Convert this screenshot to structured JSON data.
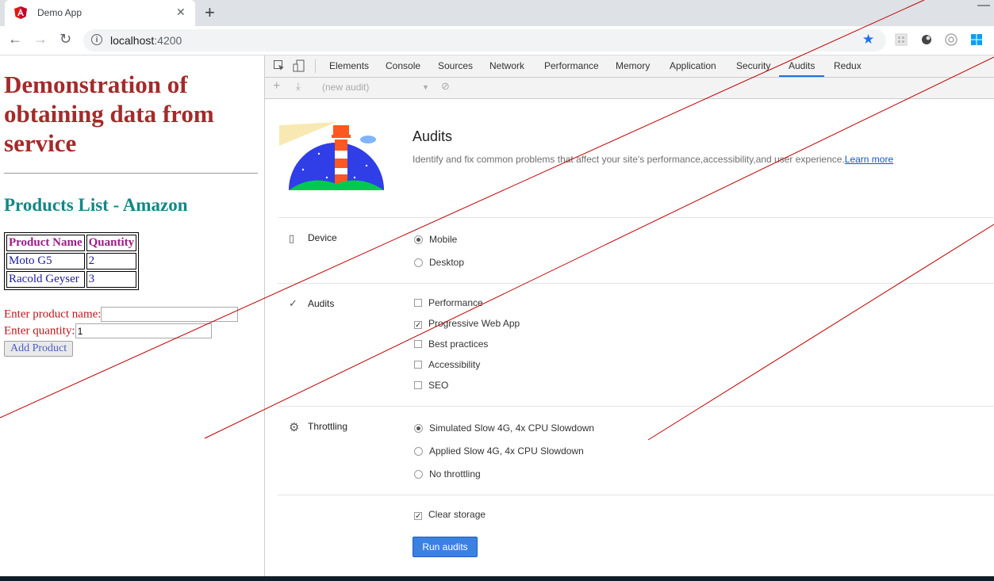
{
  "browser": {
    "tab_title": "Demo App",
    "url_host": "localhost",
    "url_port": ":4200"
  },
  "page": {
    "heading": "Demonstration of obtaining data from service",
    "subheading": "Products List - Amazon",
    "table": {
      "headers": [
        "Product Name",
        "Quantity"
      ],
      "rows": [
        [
          "Moto G5",
          "2"
        ],
        [
          "Racold Geyser",
          "3"
        ]
      ]
    },
    "form": {
      "name_label": "Enter product name:",
      "name_value": "",
      "qty_label": "Enter quantity:",
      "qty_value": "1",
      "add_button": "Add Product"
    }
  },
  "devtools": {
    "tabs": [
      "Elements",
      "Console",
      "Sources",
      "Network",
      "Performance",
      "Memory",
      "Application",
      "Security",
      "Audits",
      "Redux"
    ],
    "active_tab": "Audits",
    "audit_select": "(new audit)",
    "hero": {
      "title": "Audits",
      "description": "Identify and fix common problems that affect your site's performance,accessibility,and user experience.",
      "learn_more": "Learn more"
    },
    "device": {
      "label": "Device",
      "options": [
        {
          "label": "Mobile",
          "checked": true
        },
        {
          "label": "Desktop",
          "checked": false
        }
      ]
    },
    "audits": {
      "label": "Audits",
      "options": [
        {
          "label": "Performance",
          "checked": false
        },
        {
          "label": "Progressive Web App",
          "checked": true
        },
        {
          "label": "Best practices",
          "checked": false
        },
        {
          "label": "Accessibility",
          "checked": false
        },
        {
          "label": "SEO",
          "checked": false
        }
      ]
    },
    "throttling": {
      "label": "Throttling",
      "options": [
        {
          "label": "Simulated Slow 4G, 4x CPU Slowdown",
          "checked": true
        },
        {
          "label": "Applied Slow 4G, 4x CPU Slowdown",
          "checked": false
        },
        {
          "label": "No throttling",
          "checked": false
        }
      ]
    },
    "clear_storage": {
      "label": "Clear storage",
      "checked": true
    },
    "run_button": "Run audits"
  },
  "colors": {
    "heading": "#a52a2a",
    "subheading": "#138786",
    "accent": "#1a73e8",
    "annotation_lines": "#c00000"
  }
}
